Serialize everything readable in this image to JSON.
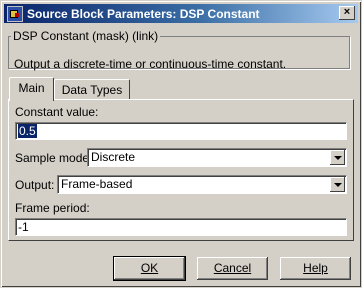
{
  "window": {
    "title": "Source Block Parameters: DSP Constant",
    "close_label": "×"
  },
  "group": {
    "legend": "DSP Constant (mask) (link)",
    "description": "Output a discrete-time or continuous-time constant."
  },
  "tabs": [
    {
      "label": "Main",
      "active": true
    },
    {
      "label": "Data Types",
      "active": false
    }
  ],
  "main": {
    "constant_label": "Constant value:",
    "constant_value": "0.5",
    "sample_mode_label": "Sample mode:",
    "sample_mode_value": "Discrete",
    "output_label": "Output:",
    "output_value": "Frame-based",
    "frame_period_label": "Frame period:",
    "frame_period_value": "-1"
  },
  "buttons": {
    "ok": "OK",
    "cancel": "Cancel",
    "help": "Help"
  },
  "icons": {
    "app": "simulink-block-icon",
    "dropdown": "chevron-down-icon"
  }
}
